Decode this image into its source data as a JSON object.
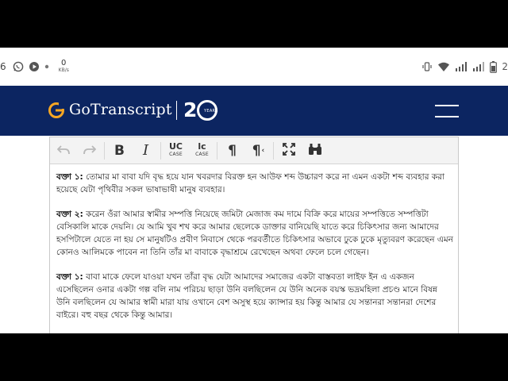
{
  "status_bar": {
    "left_number": "6",
    "speed_value": "0",
    "speed_unit": "KB/s",
    "right_text": "2"
  },
  "header": {
    "brand": "GoTranscript",
    "anniversary_number": "2",
    "anniversary_label": "YEARS",
    "bg_color": "#0c2561"
  },
  "toolbar": {
    "undo_icon": "undo-icon",
    "redo_icon": "redo-icon",
    "bold_label": "B",
    "italic_label": "I",
    "uppercase_label": "UC",
    "uppercase_sub": "CASE",
    "lowercase_label": "lc",
    "lowercase_sub": "CASE",
    "para_ltr_label": "¶",
    "para_rtl_label": "¶",
    "fullscreen_icon": "expand-icon",
    "find_icon": "binoculars-icon"
  },
  "content": {
    "paragraphs": [
      {
        "speaker": "বক্তা ১:",
        "text": " তোমার মা বাবা যদি বৃদ্ধ হয়ে যান খবরদার বিরক্ত হন আউফ শব্দ উচ্চারণ করে না এমন একটা শব্দ ব্যবহার করা হয়েছে যেটা পৃথিবীর সকল ভাষাভাষী মানুষ ব্যবহার।"
      },
      {
        "speaker": "বক্তা ২:",
        "text": " করেন ওঁরা আমার স্বামীর সম্পত্তি নিয়েছে জমিটা মেজাজ কম দামে বিক্রি করে মায়ের সম্পত্তিতে সম্পত্তিটা বেসিকালি মাকে দেয়নি। যে আমি খুব শখ করে আমার ছেলেকে ডাক্তার বানিয়েছি যাতে করে চিকিৎসার জন্য আমাদের হসপিটালে যেতে না হয় সে মানুষটিও প্রবীণ নিবাসে থেকে পরবর্তীতে চিকিৎসার অভাবে ঢুকে ঢুকে মৃত্যুবরণ করেছেন এমন কোনও আলিমকে পাবেন না তিনি তাঁর মা বাবাকে বৃদ্ধাশ্রমে রেখেছেন অথবা ফেলে চলে গেছেন।"
      },
      {
        "speaker": "বক্তা ১:",
        "text": " বাবা মাকে ফেলে যাওয়া যখন তাঁরা বৃদ্ধ যেটা আমাদের সমাজের একটা বাস্তবতা লাইফ ইন এ একজন এসেছিলেন ওনার একটা গল্প বলি নাম পরিচয় ছাড়া উনি বলছিলেন যে উনি অনেক বয়স্ক ভদ্রমহিলা প্রচণ্ড মানে বিষন্ন উনি বলছিলেন যে আমার স্বামী মারা যায় ওখানে বেশ অসুস্থ হয়ে ক্যান্সার হয় কিন্তু আমার যে সন্তানরা সন্তানরা দেশের বাইরে। বহু বছর থেকে কিন্তু আমার।"
      }
    ]
  }
}
